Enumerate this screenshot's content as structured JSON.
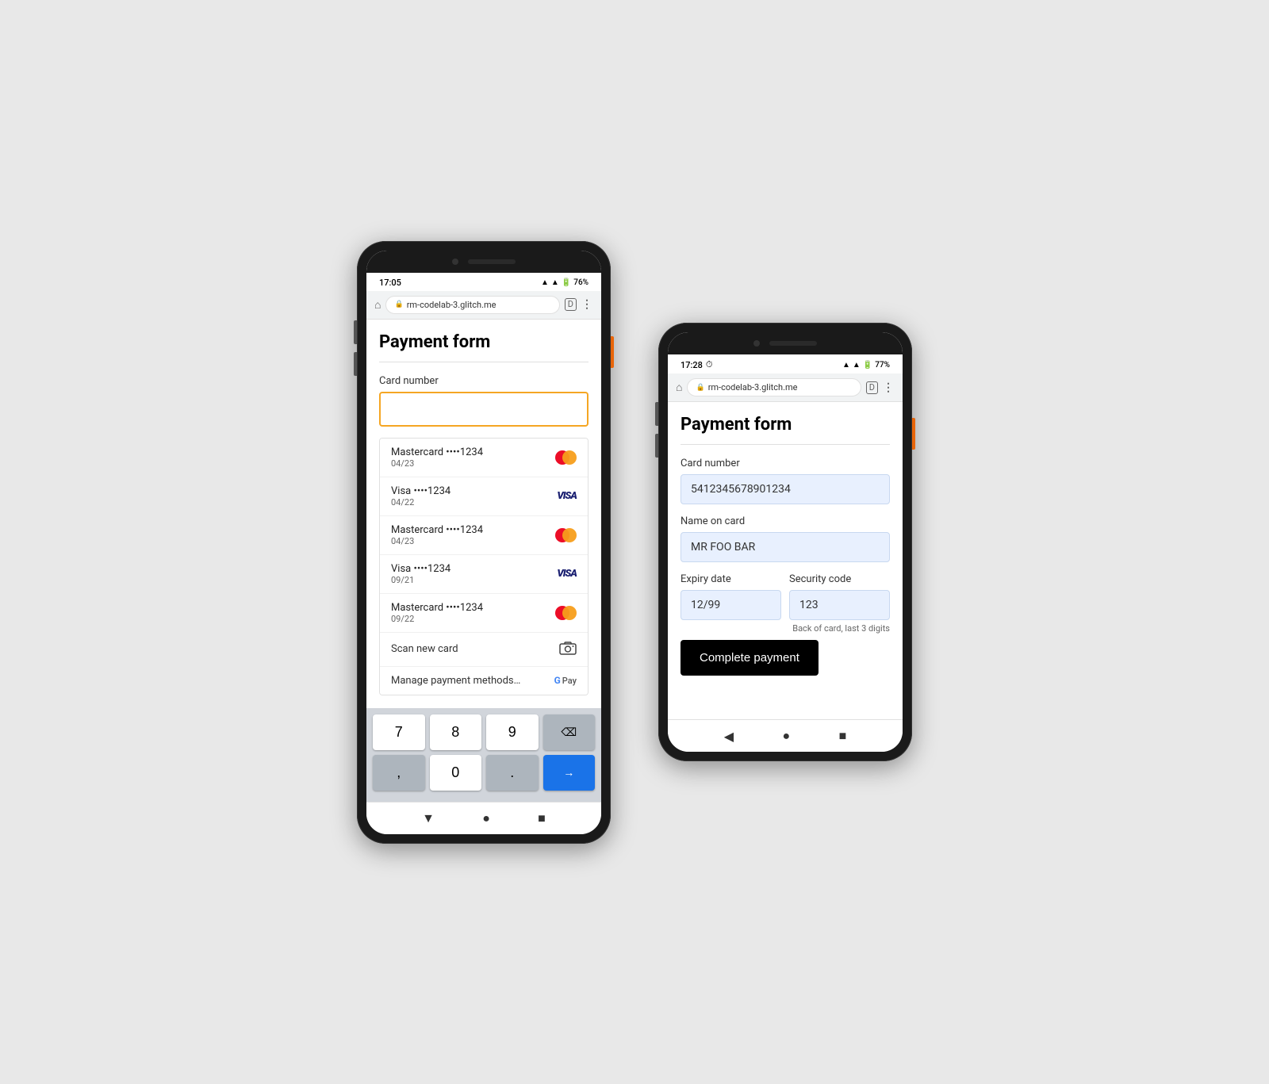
{
  "phone1": {
    "statusBar": {
      "time": "17:05",
      "batteryPercent": "76%",
      "signalIcons": "▲▲"
    },
    "browserBar": {
      "url": "rm-codelab-3.glitch.me",
      "lockIcon": "🔒"
    },
    "page": {
      "title": "Payment form",
      "cardNumberLabel": "Card number",
      "cardNumberPlaceholder": "",
      "autofillItems": [
        {
          "brand": "Mastercard",
          "dots": "••••1234",
          "expiry": "04/23",
          "type": "mastercard"
        },
        {
          "brand": "Visa",
          "dots": "••••1234",
          "expiry": "04/22",
          "type": "visa"
        },
        {
          "brand": "Mastercard",
          "dots": "••••1234",
          "expiry": "04/23",
          "type": "mastercard"
        },
        {
          "brand": "Visa",
          "dots": "••••1234",
          "expiry": "09/21",
          "type": "visa"
        },
        {
          "brand": "Mastercard",
          "dots": "••••1234",
          "expiry": "09/22",
          "type": "mastercard"
        }
      ],
      "scanNewCard": "Scan new card",
      "managePaymentMethods": "Manage payment methods…"
    },
    "keyboard": {
      "rows": [
        [
          "7",
          "8",
          "9",
          "⌫"
        ],
        [
          ",",
          "0",
          ".",
          "→"
        ]
      ]
    },
    "navBar": {
      "back": "▼",
      "home": "●",
      "recents": "■"
    }
  },
  "phone2": {
    "statusBar": {
      "time": "17:28",
      "batteryPercent": "77%",
      "extraIcon": "⏱"
    },
    "browserBar": {
      "url": "rm-codelab-3.glitch.me",
      "lockIcon": "🔒"
    },
    "page": {
      "title": "Payment form",
      "cardNumberLabel": "Card number",
      "cardNumberValue": "5412345678901234",
      "nameOnCardLabel": "Name on card",
      "nameOnCardValue": "MR FOO BAR",
      "expiryDateLabel": "Expiry date",
      "expiryDateValue": "12/99",
      "securityCodeLabel": "Security code",
      "securityCodeValue": "123",
      "securityCodeHelper": "Back of card, last 3 digits",
      "completePaymentBtn": "Complete payment"
    },
    "navBar": {
      "back": "◀",
      "home": "●",
      "recents": "■"
    }
  }
}
